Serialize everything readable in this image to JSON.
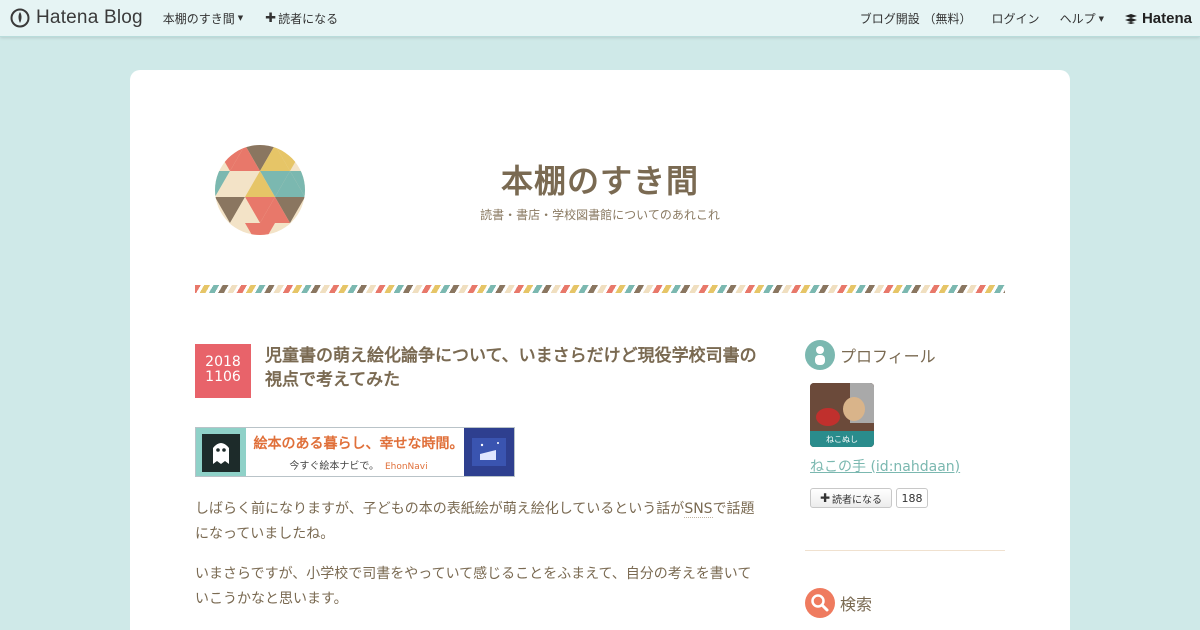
{
  "topbar": {
    "logo_text": "Hatena Blog",
    "blog_menu": "本棚のすき間",
    "subscribe": "読者になる",
    "start_blog": "ブログ開設 （無料）",
    "login": "ログイン",
    "help": "ヘルプ",
    "brand": "Hatena"
  },
  "header": {
    "title": "本棚のすき間",
    "description": "読書・書店・学校図書館についてのあれこれ"
  },
  "entry": {
    "date_year": "2018",
    "date_monthday": "1106",
    "title": "児童書の萌え絵化論争について、いまさらだけど現役学校司書の視点で考えてみた",
    "banner_main": "絵本のある暮らし、幸せな時間。",
    "banner_sub": "今すぐ絵本ナビで。",
    "banner_brand": "EhonNavi",
    "p1_before": "しばらく前になりますが、子どもの本の表紙絵が萌え絵化しているという話が",
    "p1_keyword": "SNS",
    "p1_after": "で話題になっていましたね。",
    "p2": "いまさらですが、小学校で司書をやっていて感じることをふまえて、自分の考えを書いていこうかなと思います。"
  },
  "sidebar": {
    "profile_heading": "プロフィール",
    "profile_name": "ねこの手 (id:nahdaan)",
    "profile_image_caption": "ねこぬし",
    "subscribe_label": "読者になる",
    "subscriber_count": "188",
    "search_heading": "検索"
  },
  "colors": {
    "background": "#cfe9e8",
    "accent_teal": "#7bb8b0",
    "date_red": "#e8636a",
    "text_brown": "#7a6a52",
    "search_icon": "#ef7b5f"
  }
}
